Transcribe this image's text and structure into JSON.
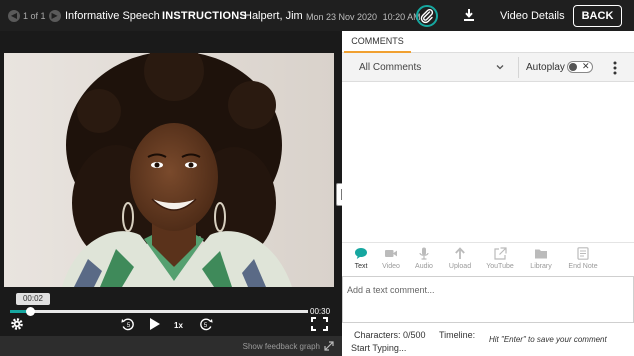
{
  "header": {
    "pager": "1 of 1",
    "assignment_title": "Informative Speech",
    "instructions_label": "INSTRUCTIONS",
    "student_name": "Halpert, Jim",
    "date": "Mon 23 Nov 2020",
    "time": "10:20 AM",
    "video_details_label": "Video Details",
    "back_label": "BACK",
    "accent_color": "#16a7a0"
  },
  "player": {
    "current_time": "00:02",
    "duration": "00:30",
    "progress": 0.067,
    "playback_speed": "1x",
    "rewind_seconds": "5",
    "forward_seconds": "5",
    "feedback_graph_label": "Show feedback graph"
  },
  "comments": {
    "tab_label": "COMMENTS",
    "filter_value": "All Comments",
    "autoplay_label": "Autoplay",
    "autoplay_on": false,
    "tools": [
      {
        "label": "Text",
        "icon": "speech-bubble-icon",
        "active": true
      },
      {
        "label": "Video",
        "icon": "video-camera-icon",
        "active": false
      },
      {
        "label": "Audio",
        "icon": "microphone-icon",
        "active": false
      },
      {
        "label": "Upload",
        "icon": "upload-arrow-icon",
        "active": false
      },
      {
        "label": "YouTube",
        "icon": "external-link-icon",
        "active": false
      },
      {
        "label": "Library",
        "icon": "folder-icon",
        "active": false
      },
      {
        "label": "End Note",
        "icon": "note-icon",
        "active": false
      }
    ],
    "input_placeholder": "Add a text comment...",
    "characters_text": "Characters: 0/500",
    "timeline_label": "Timeline:",
    "start_typing": "Start Typing...",
    "hint": "Hit \"Enter\" to save your comment"
  }
}
